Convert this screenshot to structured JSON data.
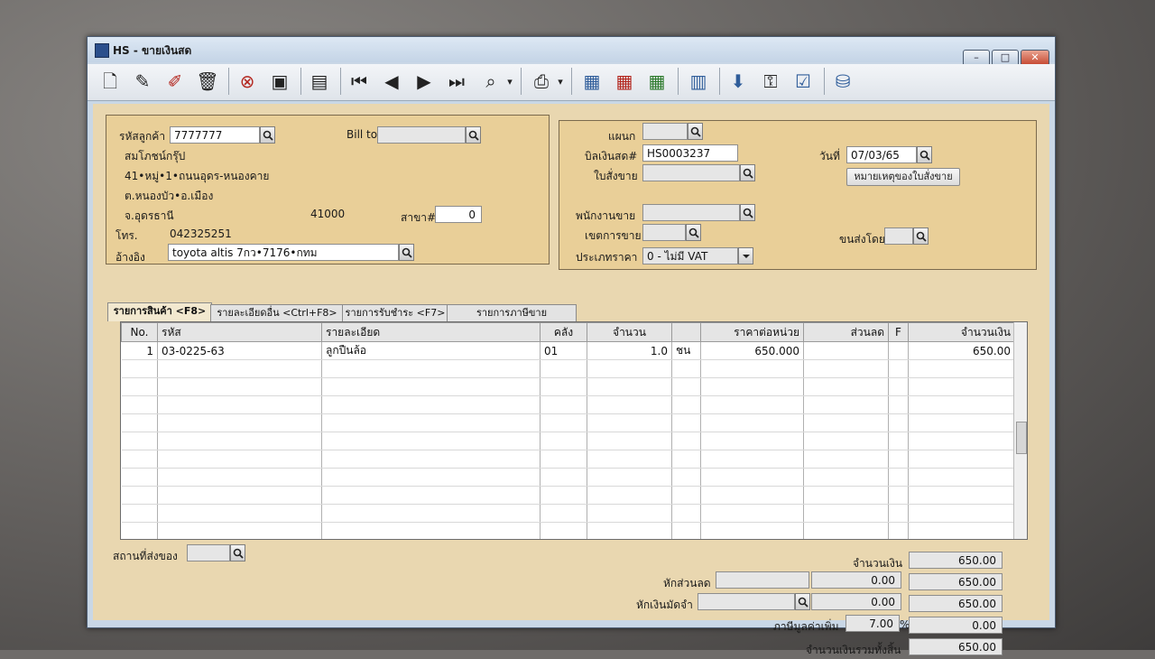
{
  "window": {
    "title": "HS - ขายเงินสด"
  },
  "toolbar": {
    "icons": [
      "new-icon",
      "edit-icon",
      "clear-icon",
      "delete-icon",
      "cancel-icon",
      "save-icon",
      "print-preview-icon",
      "first-icon",
      "prev-icon",
      "next-icon",
      "last-icon",
      "find-icon",
      "printer-icon",
      "report-icon",
      "report2-icon",
      "export-icon",
      "calculator-icon",
      "approve-icon",
      "lock-icon",
      "ok-icon",
      "database-icon"
    ]
  },
  "customer": {
    "code_label": "รหัสลูกค้า",
    "code": "7777777",
    "billto_label": "Bill to",
    "billto": "",
    "name": "สมโภชน์กรุ๊ป",
    "address1": "41•หมู่•1•ถนนอุดร-หนองคาย",
    "address2": "ต.หนองบัว•อ.เมือง",
    "address3": "จ.อุดรธานี",
    "postcode": "41000",
    "branch_label": "สาขา#",
    "branch": "0",
    "phone_label": "โทร.",
    "phone": "042325251",
    "ref_label": "อ้างอิง",
    "ref": "toyota altis 7กว•7176•กทม"
  },
  "document": {
    "dept_label": "แผนก",
    "dept": "",
    "bill_label": "บิลเงินสด#",
    "bill": "HS0003237",
    "date_label": "วันที่",
    "date": "07/03/65",
    "so_label": "ใบสั่งขาย",
    "so": "",
    "note_button": "หมายเหตุของใบสั่งขาย",
    "salesman_label": "พนักงานขาย",
    "salesman": "",
    "area_label": "เขตการขาย",
    "area": "",
    "ship_label": "ขนส่งโดย",
    "ship": "",
    "pricetype_label": "ประเภทราคา",
    "pricetype": "0 - ไม่มี VAT"
  },
  "tabs": [
    "รายการสินค้า <F8>",
    "รายละเอียดอื่น <Ctrl+F8>",
    "รายการรับชำระ <F7>",
    "รายการภาษีขาย <Ctrl+F7>"
  ],
  "grid": {
    "columns": [
      "No.",
      "รหัส",
      "รายละเอียด",
      "คลัง",
      "จำนวน",
      "",
      "ราคาต่อหน่วย",
      "ส่วนลด",
      "F",
      "จำนวนเงิน"
    ],
    "rows": [
      [
        "1",
        "03-0225-63",
        "ลูกปืนล้อ",
        "01",
        "1.0",
        "ชน",
        "650.000",
        "",
        "",
        "650.00"
      ]
    ]
  },
  "footer": {
    "ship_place_label": "สถานที่ส่งของ",
    "ship_place": "",
    "amount_label": "จำนวนเงิน",
    "amount": "650.00",
    "discount_label": "หักส่วนลด",
    "discount_text": "",
    "discount_value": "0.00",
    "after_discount": "650.00",
    "deposit_label": "หักเงินมัดจำ",
    "deposit_text": "",
    "deposit_value": "0.00",
    "after_deposit": "650.00",
    "vat_label": "ภาษีมูลค่าเพิ่ม",
    "vat_rate": "7.00",
    "vat_unit": "%",
    "vat_amount": "0.00",
    "total_label": "จำนวนเงินรวมทั้งสิ้น",
    "total": "650.00"
  }
}
